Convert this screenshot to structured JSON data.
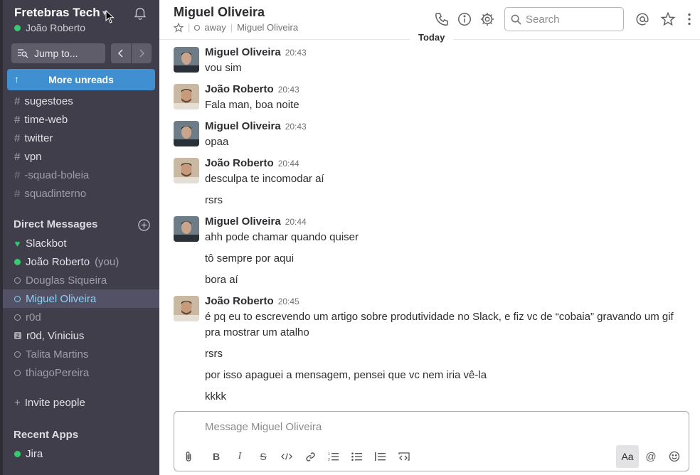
{
  "team": {
    "name": "Fretebras Tech",
    "user": "João Roberto"
  },
  "sidebar": {
    "jump_label": "Jump to...",
    "more_unreads": "More unreads",
    "channels": [
      {
        "name": "sugestoes",
        "muted": false
      },
      {
        "name": "time-web",
        "muted": false
      },
      {
        "name": "twitter",
        "muted": false
      },
      {
        "name": "vpn",
        "muted": false
      },
      {
        "name": "-squad-boleia",
        "muted": true
      },
      {
        "name": "squadinterno",
        "muted": true
      }
    ],
    "dm_title": "Direct Messages",
    "dms": [
      {
        "name": "Slackbot",
        "status": "heart"
      },
      {
        "name": "João Roberto",
        "suffix": "(you)",
        "status": "online"
      },
      {
        "name": "Douglas Siqueira",
        "status": "away"
      },
      {
        "name": "Miguel Oliveira",
        "status": "active"
      },
      {
        "name": "r0d",
        "status": "away"
      },
      {
        "name": "r0d, Vinicius",
        "status": "group",
        "badge": "2"
      },
      {
        "name": "Talita Martins",
        "status": "away"
      },
      {
        "name": "thiagoPereira",
        "status": "away"
      }
    ],
    "invite_label": "Invite people",
    "apps_title": "Recent Apps",
    "apps": [
      {
        "name": "Jira",
        "status": "online"
      }
    ]
  },
  "header": {
    "title": "Miguel Oliveira",
    "presence": "away",
    "subtitle_name": "Miguel Oliveira",
    "search_placeholder": "Search"
  },
  "divider_label": "Today",
  "messages": [
    {
      "author": "Miguel Oliveira",
      "time": "20:43",
      "lines": [
        "vou sim"
      ]
    },
    {
      "author": "João Roberto",
      "time": "20:43",
      "lines": [
        "Fala man, boa noite"
      ]
    },
    {
      "author": "Miguel Oliveira",
      "time": "20:43",
      "lines": [
        "opaa"
      ]
    },
    {
      "author": "João Roberto",
      "time": "20:44",
      "lines": [
        "desculpa te incomodar aí",
        "rsrs"
      ]
    },
    {
      "author": "Miguel Oliveira",
      "time": "20:44",
      "lines": [
        "ahh pode chamar quando quiser",
        "tô sempre por aqui",
        "bora aí"
      ]
    },
    {
      "author": "João Roberto",
      "time": "20:45",
      "lines": [
        "é pq eu to escrevendo um artigo sobre produtividade no Slack, e fiz vc de “cobaia” gravando um gif pra mostrar um atalho",
        "rsrs",
        "por isso apaguei a mensagem, pensei que vc nem iria vê-la",
        "kkkk"
      ]
    }
  ],
  "composer": {
    "placeholder": "Message Miguel Oliveira",
    "aa_label": "Aa"
  },
  "colors": {
    "accent": "#3f8fd1",
    "online": "#38c972",
    "sidebar": "#3f3e4a",
    "active_dm": "#8fd0f2"
  }
}
